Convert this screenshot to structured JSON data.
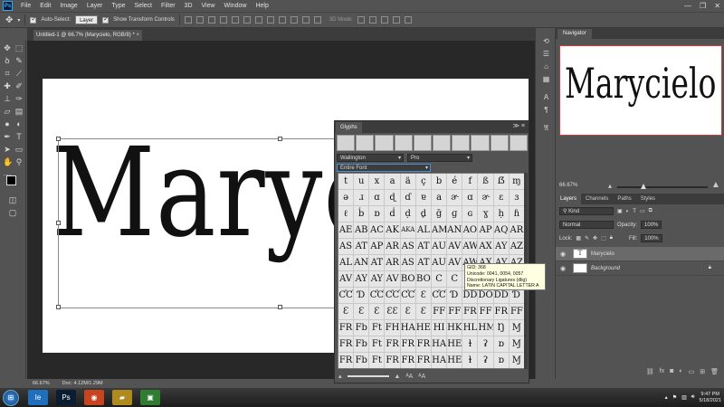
{
  "app": {
    "logo_text": "Ps"
  },
  "menu": [
    "File",
    "Edit",
    "Image",
    "Layer",
    "Type",
    "Select",
    "Filter",
    "3D",
    "View",
    "Window",
    "Help"
  ],
  "window_controls": {
    "minimize": "—",
    "restore": "❐",
    "close": "✕"
  },
  "options_bar": {
    "auto_select_label": "Auto-Select:",
    "auto_select_value": "Layer",
    "show_transform_label": "Show Transform Controls",
    "mode_3d_label": "3D Mode:"
  },
  "document": {
    "tab_title": "Untitled-1 @ 66.7% (Marycielo, RGB/8) *",
    "canvas_text": "Marycielo",
    "zoom": "66.67%",
    "doc_info": "Doc: 4.12M/1.29M"
  },
  "navigator": {
    "tab": "Navigator",
    "zoom": "66.67%"
  },
  "layers_panel": {
    "tabs": [
      "Layers",
      "Channels",
      "Paths",
      "Styles"
    ],
    "kind_label": "Kind",
    "blend_mode": "Normal",
    "opacity_label": "Opacity:",
    "opacity_value": "100%",
    "lock_label": "Lock:",
    "fill_label": "Fill:",
    "fill_value": "100%",
    "layers": [
      {
        "name": "Marycielo",
        "thumb": "T",
        "type": "text"
      },
      {
        "name": "Background",
        "thumb": "",
        "type": "background"
      }
    ]
  },
  "glyphs_panel": {
    "tab": "Glyphs",
    "font_family": "Wallington",
    "font_style": "Pro",
    "filter": "Entire Font",
    "glyphs": [
      "t",
      "u",
      "x",
      "a",
      "ä",
      "ç",
      "b",
      "é",
      "f",
      "ß",
      "ẞ",
      "ɱ",
      "ǝ",
      "ɹ",
      "ɑ",
      "ɖ",
      "ɗ",
      "ɐ",
      "a",
      "ɚ",
      "ɑ",
      "ɚ",
      "ɛ",
      "ɜ",
      "ℓ",
      "ḃ",
      "ɒ",
      "ḋ",
      "ḍ",
      "ḏ",
      "ḡ",
      "ɡ",
      "ɢ",
      "ɣ",
      "ḥ",
      "ɦ",
      "AE",
      "AB",
      "AC",
      "AK",
      "AKA",
      "AL",
      "AM",
      "AN",
      "AO",
      "AP",
      "AQ",
      "AR",
      "AS",
      "AT",
      "AP",
      "AR",
      "AS",
      "AT",
      "AU",
      "AV",
      "AW",
      "AX",
      "AY",
      "AZ",
      "AL",
      "AN",
      "AT",
      "AR",
      "AS",
      "AT",
      "AU",
      "AV",
      "AW",
      "AX",
      "AY",
      "AZ",
      "AV",
      "AY",
      "AY",
      "AV",
      "BO",
      "BO",
      "C",
      "C",
      "C",
      "C",
      "C",
      "C",
      "ƇƇ",
      "Ɗ",
      "ƇƇ",
      "ƇƇ",
      "ƇƇ",
      "Ɛ",
      "ƇƇ",
      "Ɗ",
      "DD",
      "DO",
      "DD",
      "Ɗ",
      "Ɛ",
      "Ɛ",
      "Ɛ",
      "ƐƐ",
      "Ɛ",
      "Ɛ",
      "FF",
      "FF",
      "FR",
      "FF",
      "FR",
      "FF",
      "FR",
      "Fb",
      "Ft",
      "FH",
      "HA",
      "HE",
      "HI",
      "HK",
      "HL",
      "HM",
      "Ŋ",
      "Ɱ",
      "FR",
      "Fb",
      "Ft",
      "FR",
      "FR",
      "FR",
      "HA",
      "HE",
      "ɫ",
      "ʡ",
      "ɒ",
      "Ɱ",
      "FR",
      "Fb",
      "Ft",
      "FR",
      "FR",
      "FR",
      "HA",
      "HE",
      "ɫ",
      "ʡ",
      "ɒ",
      "Ɱ"
    ],
    "tooltip": [
      "GID: 368",
      "Unicode: 0041, 0054, 0057",
      "Discretionary Ligatures (dlig)",
      "Name: LATIN CAPITAL LETTER A"
    ]
  },
  "taskbar": {
    "start_label": "⊞",
    "apps": [
      {
        "name": "Ie",
        "color": "#1f6fbf"
      },
      {
        "name": "Ps",
        "color": "#0b1d33"
      },
      {
        "name": "◉",
        "color": "#c8441f"
      },
      {
        "name": "▰",
        "color": "#b08a1f"
      },
      {
        "name": "▣",
        "color": "#2e7d32"
      }
    ],
    "time": "9:47 PM",
    "date": "5/18/2021"
  },
  "colors": {
    "accent": "#31a8ff",
    "panel": "#535353",
    "panel_dark": "#3c3c3c",
    "canvas_bg": "#282828"
  }
}
